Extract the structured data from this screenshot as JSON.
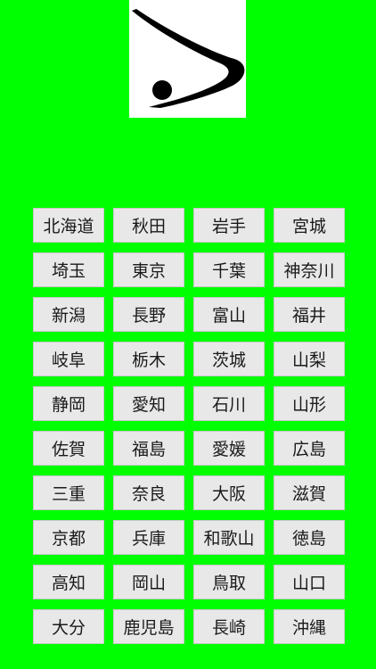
{
  "quiz": {
    "shape_icon": "prefecture-silhouette"
  },
  "prefectures": [
    {
      "label": "北海道"
    },
    {
      "label": "秋田"
    },
    {
      "label": "岩手"
    },
    {
      "label": "宮城"
    },
    {
      "label": "埼玉"
    },
    {
      "label": "東京"
    },
    {
      "label": "千葉"
    },
    {
      "label": "神奈川"
    },
    {
      "label": "新潟"
    },
    {
      "label": "長野"
    },
    {
      "label": "富山"
    },
    {
      "label": "福井"
    },
    {
      "label": "岐阜"
    },
    {
      "label": "栃木"
    },
    {
      "label": "茨城"
    },
    {
      "label": "山梨"
    },
    {
      "label": "静岡"
    },
    {
      "label": "愛知"
    },
    {
      "label": "石川"
    },
    {
      "label": "山形"
    },
    {
      "label": "佐賀"
    },
    {
      "label": "福島"
    },
    {
      "label": "愛媛"
    },
    {
      "label": "広島"
    },
    {
      "label": "三重"
    },
    {
      "label": "奈良"
    },
    {
      "label": "大阪"
    },
    {
      "label": "滋賀"
    },
    {
      "label": "京都"
    },
    {
      "label": "兵庫"
    },
    {
      "label": "和歌山"
    },
    {
      "label": "徳島"
    },
    {
      "label": "高知"
    },
    {
      "label": "岡山"
    },
    {
      "label": "鳥取"
    },
    {
      "label": "山口"
    },
    {
      "label": "大分"
    },
    {
      "label": "鹿児島"
    },
    {
      "label": "長崎"
    },
    {
      "label": "沖縄"
    }
  ],
  "colors": {
    "background": "#00ff00",
    "button": "#e8e8e8",
    "shape": "#000000"
  }
}
